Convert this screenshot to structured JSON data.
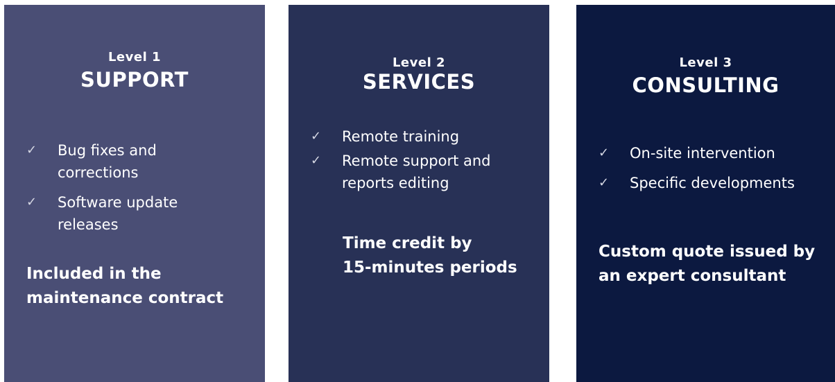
{
  "panels": [
    {
      "level": "Level 1",
      "tier": "SUPPORT",
      "features": [
        "Bug fixes and\ncorrections",
        "Software update\nreleases"
      ],
      "note": "Included in the\nmaintenance contract",
      "background": "#4a4e75"
    },
    {
      "level": "Level 2",
      "tier": "SERVICES",
      "features": [
        "Remote training",
        "Remote support and\nreports editing"
      ],
      "note": "Time credit by\n15-minutes periods",
      "background": "#283156"
    },
    {
      "level": "Level 3",
      "tier": "CONSULTING",
      "features": [
        "On-site intervention",
        "Specific developments"
      ],
      "note": "Custom quote issued by\nan expert consultant",
      "background": "#0c1940"
    }
  ],
  "check_icon": "checkmark-icon",
  "check_glyph": "✓"
}
